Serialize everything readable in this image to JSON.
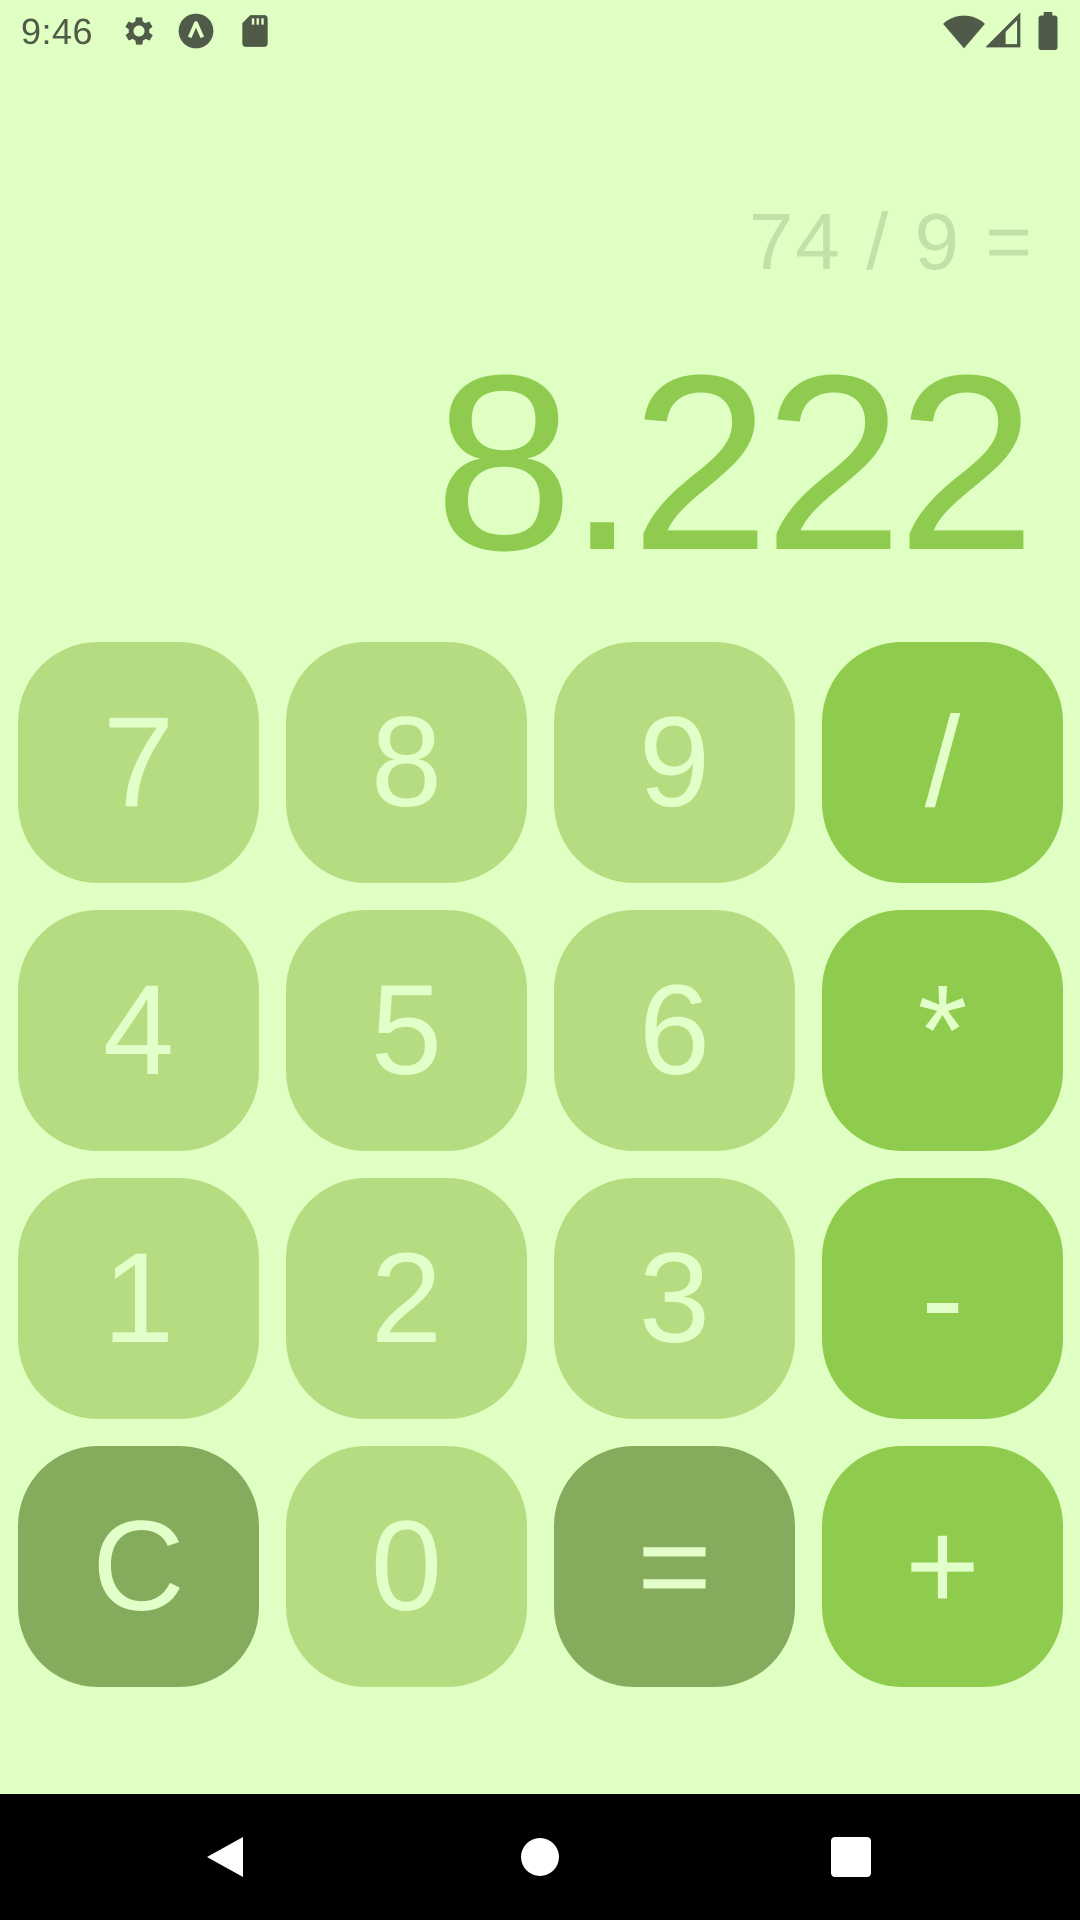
{
  "status_bar": {
    "time": "9:46",
    "icons": [
      "gear-icon",
      "app-notification-icon",
      "sd-card-icon",
      "wifi-icon",
      "signal-icon",
      "battery-icon"
    ]
  },
  "display": {
    "expression": "74 / 9 =",
    "result": "8.222"
  },
  "keypad": {
    "keys": [
      {
        "label": "7",
        "kind": "digit"
      },
      {
        "label": "8",
        "kind": "digit"
      },
      {
        "label": "9",
        "kind": "digit"
      },
      {
        "label": "/",
        "kind": "op"
      },
      {
        "label": "4",
        "kind": "digit"
      },
      {
        "label": "5",
        "kind": "digit"
      },
      {
        "label": "6",
        "kind": "digit"
      },
      {
        "label": "*",
        "kind": "op"
      },
      {
        "label": "1",
        "kind": "digit"
      },
      {
        "label": "2",
        "kind": "digit"
      },
      {
        "label": "3",
        "kind": "digit"
      },
      {
        "label": "-",
        "kind": "op"
      },
      {
        "label": "C",
        "kind": "action"
      },
      {
        "label": "0",
        "kind": "digit"
      },
      {
        "label": "=",
        "kind": "action"
      },
      {
        "label": "+",
        "kind": "op"
      }
    ]
  },
  "colors": {
    "background": "#e0ffc3",
    "digit_key": "#b5dc80",
    "operator_key": "#8fcb4d",
    "action_key": "#85ab5c",
    "key_text": "#e3ffc9",
    "result_text": "#8ecb4f",
    "expression_text": "#c2e0a8"
  },
  "nav_bar": {
    "icons": [
      "back-icon",
      "home-icon",
      "recents-icon"
    ]
  }
}
